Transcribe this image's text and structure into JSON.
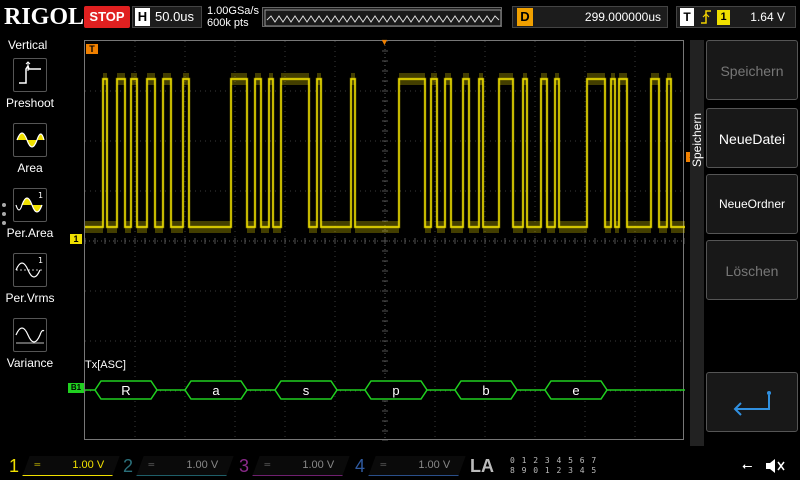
{
  "brand": "RIGOL",
  "status": "STOP",
  "timebase": {
    "label": "H",
    "value": "50.0us"
  },
  "sample_rate": "1.00GSa/s",
  "memory_depth": "600k pts",
  "delay": {
    "label": "D",
    "value": "299.000000us"
  },
  "trigger": {
    "label": "T",
    "icon": "rising-edge-icon",
    "source": "1",
    "level": "1.64 V"
  },
  "left_menu": {
    "title": "Vertical",
    "items": [
      {
        "label": "Preshoot",
        "icon": "preshoot-icon"
      },
      {
        "label": "Area",
        "icon": "area-icon"
      },
      {
        "label": "Per.Area",
        "icon": "period-area-icon"
      },
      {
        "label": "Per.Vrms",
        "icon": "period-vrms-icon"
      },
      {
        "label": "Variance",
        "icon": "variance-icon"
      }
    ]
  },
  "right_menu": {
    "title": "Speichern",
    "buttons": [
      {
        "label": "Speichern",
        "enabled": false
      },
      {
        "label": "NeueDatei",
        "enabled": true
      },
      {
        "label": "NeueOrdner",
        "enabled": true
      },
      {
        "label": "Löschen",
        "enabled": false
      }
    ],
    "return_icon": "return-arrow-icon"
  },
  "screen": {
    "bus_label": "Tx[ASC]",
    "bus_marker": "B1",
    "channel_marker": "1",
    "trigger_marker": "T",
    "decoded": [
      "R",
      "a",
      "s",
      "p",
      "b",
      "e"
    ]
  },
  "channels": [
    {
      "num": "1",
      "scale": "1.00 V",
      "color": "#f0e000",
      "active": true
    },
    {
      "num": "2",
      "scale": "1.00 V",
      "color": "#00b0c8",
      "active": false
    },
    {
      "num": "3",
      "scale": "1.00 V",
      "color": "#d030d0",
      "active": false
    },
    {
      "num": "4",
      "scale": "1.00 V",
      "color": "#3070e0",
      "active": false
    }
  ],
  "la": {
    "label": "LA",
    "row1": "0 1 2 3  4 5 6 7",
    "row2": "8 9 0 1  2 3 4 5"
  },
  "colors": {
    "ch1": "#f0e000",
    "bus": "#20d020",
    "trigger": "#f08000"
  }
}
